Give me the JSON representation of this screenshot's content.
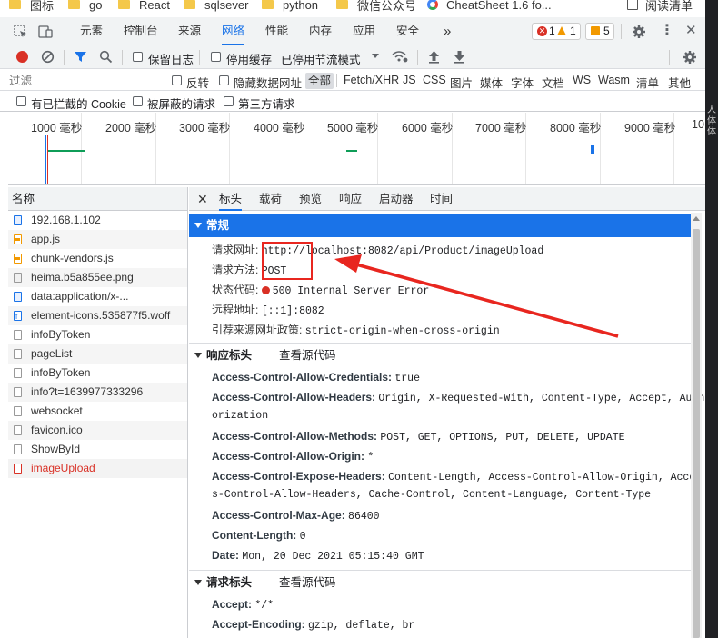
{
  "bookmarks": [
    {
      "label": "图标",
      "icon": "folder-icon"
    },
    {
      "label": "go",
      "icon": "folder-icon"
    },
    {
      "label": "React",
      "icon": "folder-icon"
    },
    {
      "label": "sqlsever",
      "icon": "folder-icon"
    },
    {
      "label": "python",
      "icon": "folder-icon"
    },
    {
      "label": "微信公众号",
      "icon": "folder-icon"
    },
    {
      "label": "CheatSheet 1.6 fo...",
      "icon": "chrome-icon"
    },
    {
      "label": "阅读清单",
      "icon": "reading-list-icon"
    }
  ],
  "devtools_tabs": [
    "元素",
    "控制台",
    "来源",
    "网络",
    "性能",
    "内存",
    "应用",
    "安全"
  ],
  "devtools_active_tab": "网络",
  "more_tabs_glyph": "»",
  "badges": {
    "errors": "1",
    "warnings": "1",
    "issues": "5"
  },
  "toolbar": {
    "preserve_log": "保留日志",
    "disable_cache": "停用缓存",
    "throttling": "已停用节流模式"
  },
  "filter": {
    "placeholder": "过滤",
    "invert": "反转",
    "hide_data_urls": "隐藏数据网址",
    "types": [
      "全部",
      "Fetch/XHR",
      "JS",
      "CSS",
      "图片",
      "媒体",
      "字体",
      "文档",
      "WS",
      "Wasm",
      "清单",
      "其他"
    ],
    "active_type": "全部"
  },
  "blocked": {
    "blocked_cookies": "有已拦截的 Cookie",
    "blocked_requests": "被屏蔽的请求",
    "third_party": "第三方请求"
  },
  "timeline_ticks": [
    "1000 毫秒",
    "2000 毫秒",
    "3000 毫秒",
    "4000 毫秒",
    "5000 毫秒",
    "6000 毫秒",
    "7000 毫秒",
    "8000 毫秒",
    "9000 毫秒",
    "10"
  ],
  "requests_header": "名称",
  "requests": [
    {
      "name": "192.168.1.102",
      "type": "doc"
    },
    {
      "name": "app.js",
      "type": "js"
    },
    {
      "name": "chunk-vendors.js",
      "type": "js"
    },
    {
      "name": "heima.b5a855ee.png",
      "type": "img"
    },
    {
      "name": "data:application/x-...",
      "type": "doc"
    },
    {
      "name": "element-icons.535877f5.woff",
      "type": "font"
    },
    {
      "name": "infoByToken",
      "type": "plain"
    },
    {
      "name": "pageList",
      "type": "plain"
    },
    {
      "name": "infoByToken",
      "type": "plain"
    },
    {
      "name": "info?t=1639977333296",
      "type": "plain"
    },
    {
      "name": "websocket",
      "type": "plain"
    },
    {
      "name": "favicon.ico",
      "type": "plain"
    },
    {
      "name": "ShowById",
      "type": "plain"
    },
    {
      "name": "imageUpload",
      "type": "error"
    }
  ],
  "detail_tabs": [
    "标头",
    "载荷",
    "预览",
    "响应",
    "启动器",
    "时间"
  ],
  "detail_active_tab": "标头",
  "general": {
    "title": "常规",
    "request_url_label": "请求网址:",
    "request_url": "http://localhost:8082/api/Product/imageUpload",
    "request_method_label": "请求方法:",
    "request_method": "POST",
    "status_code_label": "状态代码:",
    "status_code": "500 Internal Server Error",
    "remote_address_label": "远程地址:",
    "remote_address": "[::1]:8082",
    "referrer_policy_label": "引荐来源网址政策:",
    "referrer_policy": "strict-origin-when-cross-origin"
  },
  "response_headers": {
    "title": "响应标头",
    "view_source": "查看源代码",
    "items": [
      {
        "key": "Access-Control-Allow-Credentials:",
        "value": "true"
      },
      {
        "key": "Access-Control-Allow-Headers:",
        "value": "Origin, X-Requested-With, Content-Type, Accept, Auth",
        "wrap": "orization"
      },
      {
        "key": "Access-Control-Allow-Methods:",
        "value": "POST, GET, OPTIONS, PUT, DELETE, UPDATE"
      },
      {
        "key": "Access-Control-Allow-Origin:",
        "value": "*"
      },
      {
        "key": "Access-Control-Expose-Headers:",
        "value": "Content-Length, Access-Control-Allow-Origin, Acces",
        "wrap": "s-Control-Allow-Headers, Cache-Control, Content-Language, Content-Type"
      },
      {
        "key": "Access-Control-Max-Age:",
        "value": "86400"
      },
      {
        "key": "Content-Length:",
        "value": "0"
      },
      {
        "key": "Date:",
        "value": "Mon, 20 Dec 2021 05:15:40 GMT"
      }
    ]
  },
  "request_headers": {
    "title": "请求标头",
    "view_source": "查看源代码",
    "items": [
      {
        "key": "Accept:",
        "value": "*/*"
      },
      {
        "key": "Accept-Encoding:",
        "value": "gzip, deflate, br"
      }
    ]
  },
  "sidestrip_glyphs": [
    "人",
    "体",
    "体"
  ],
  "colors": {
    "accent": "#1a73e8",
    "error": "#d93025",
    "annotation": "#e8261f"
  }
}
